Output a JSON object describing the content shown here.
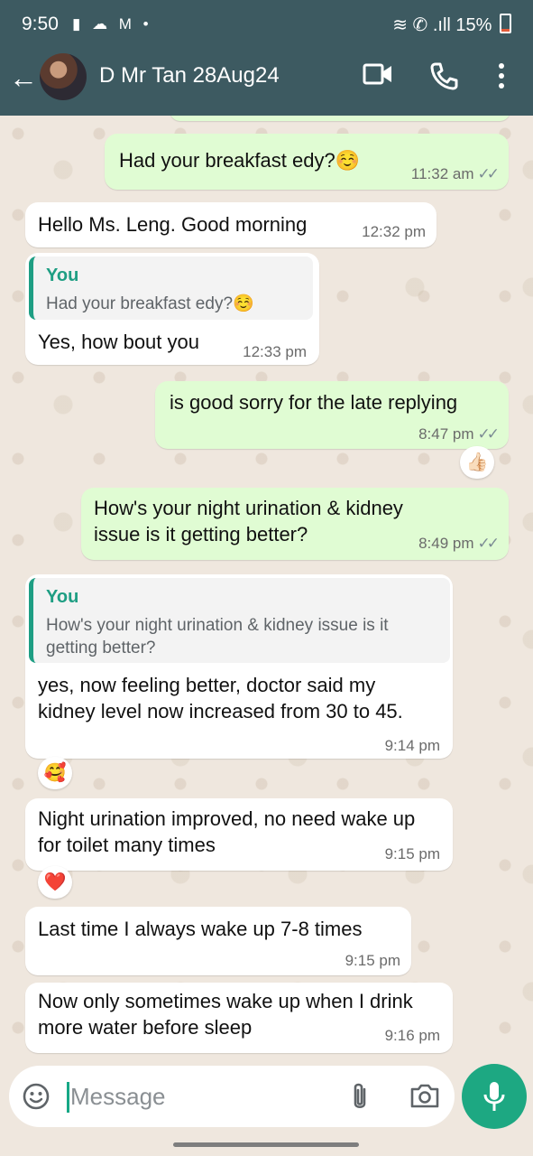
{
  "status_bar": {
    "time": "9:50",
    "left_icons": "▮ ☁ M •",
    "battery": "15%"
  },
  "header": {
    "back_icon": "←",
    "contact_name": "D Mr Tan 28Aug24"
  },
  "messages": [
    {
      "direction": "out",
      "text": "Had your breakfast edy?☺️",
      "time": "11:32 am",
      "ticks": "✓✓"
    },
    {
      "direction": "in",
      "text": "Hello Ms. Leng. Good morning",
      "time": "12:32 pm"
    },
    {
      "direction": "in",
      "quote_name": "You",
      "quote_text": "Had your breakfast edy?☺️",
      "text": "Yes, how bout you",
      "time": "12:33 pm"
    },
    {
      "direction": "out",
      "text": "is good sorry for the late replying",
      "time": "8:47 pm",
      "ticks": "✓✓",
      "reaction": "👍🏻"
    },
    {
      "direction": "out",
      "text": "How's your night urination & kidney issue is it getting better?",
      "time": "8:49 pm",
      "ticks": "✓✓"
    },
    {
      "direction": "in",
      "quote_name": "You",
      "quote_text": "How's your night urination & kidney issue is it getting better?",
      "text": "yes, now feeling better, doctor said my kidney level now increased from 30 to 45.",
      "time": "9:14 pm",
      "reaction": "🥰"
    },
    {
      "direction": "in",
      "text": "Night urination improved, no need wake up for toilet many times",
      "time": "9:15 pm",
      "reaction": "❤️"
    },
    {
      "direction": "in",
      "text": "Last time I always wake up 7-8 times",
      "time": "9:15 pm"
    },
    {
      "direction": "in",
      "text": "Now only sometimes wake up when I drink more water before sleep",
      "time": "9:16 pm"
    }
  ],
  "composer": {
    "placeholder": "Message"
  },
  "colors": {
    "header": "#3d5a61",
    "outgoing": "#e0fcd3",
    "incoming": "#ffffff",
    "accent": "#1da882",
    "background": "#efe7de"
  },
  "icons": [
    "back-arrow-icon",
    "video-call-icon",
    "phone-icon",
    "more-menu-icon",
    "emoji-icon",
    "attach-icon",
    "camera-icon",
    "mic-icon"
  ]
}
